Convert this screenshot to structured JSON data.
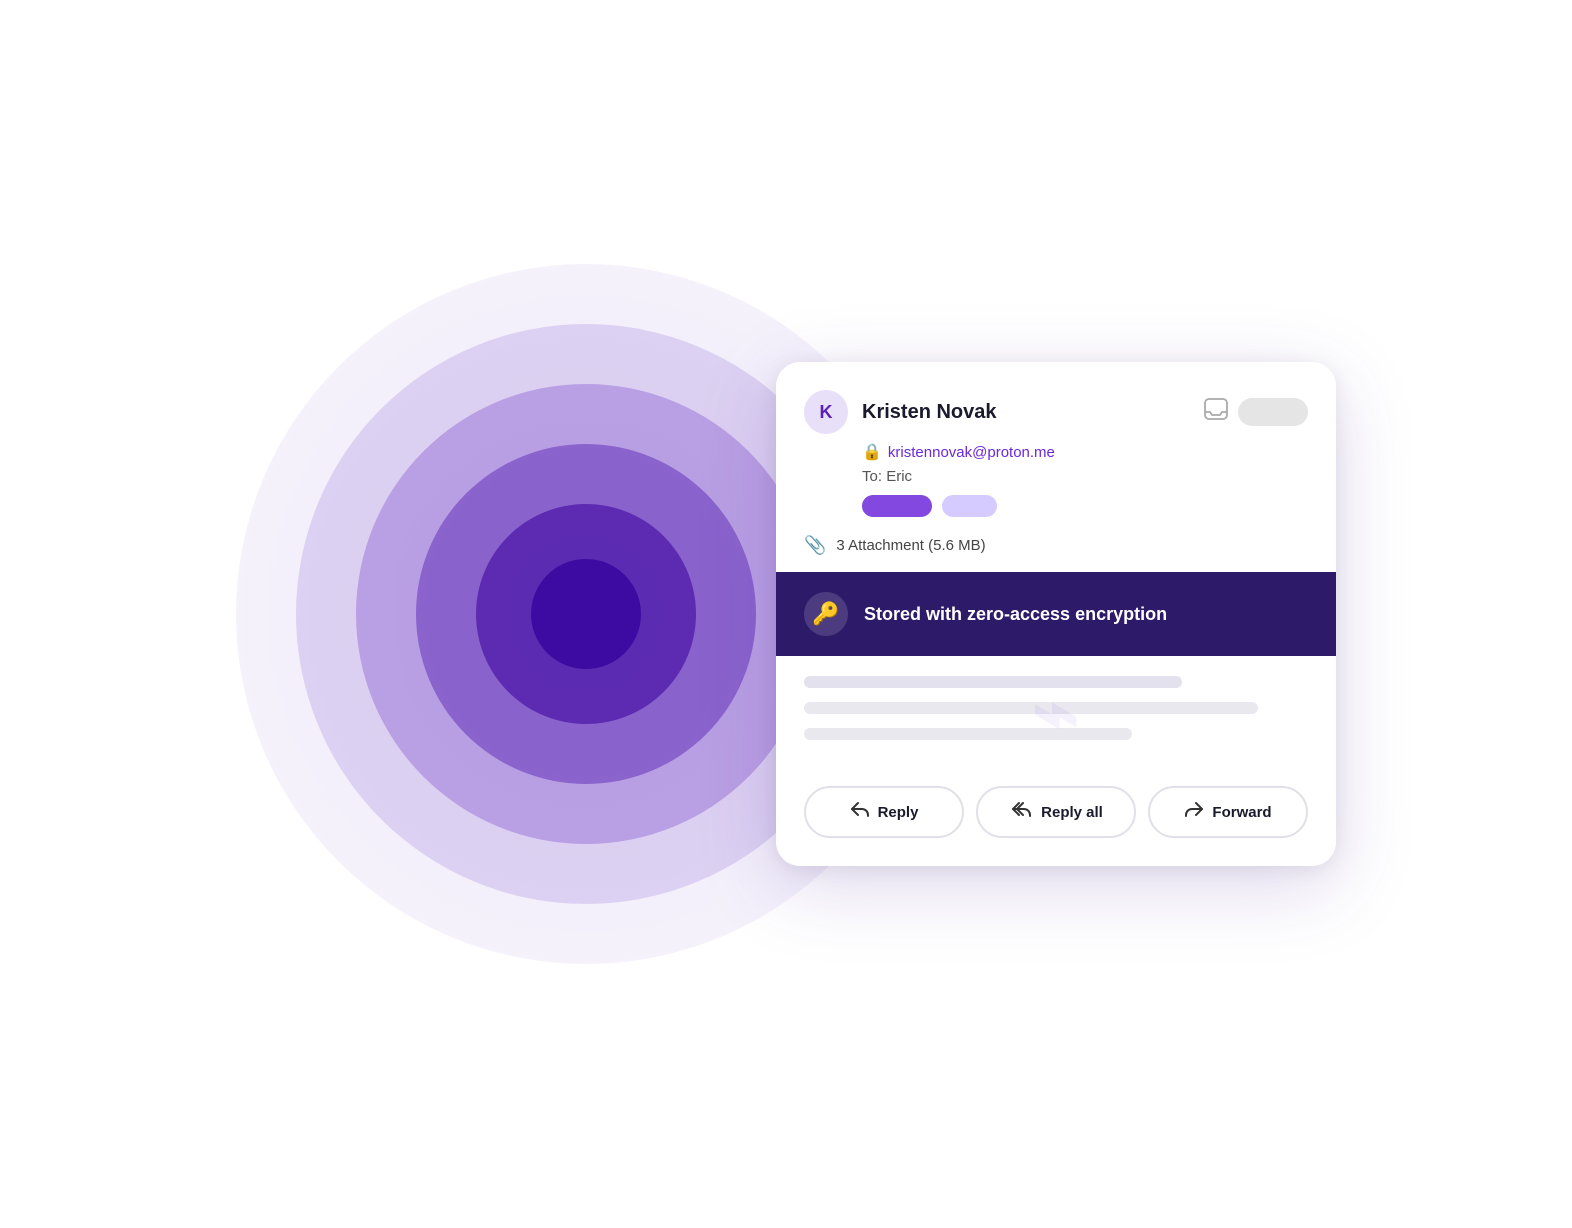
{
  "background": {
    "colors": {
      "outermost": "#e8e0f8",
      "ring2": "#c4b5fd",
      "ring3": "#a78bfa",
      "ring4": "#7c3aed",
      "ring5": "#5b21b6",
      "center": "#3b0f9e"
    }
  },
  "email_card": {
    "sender": {
      "avatar_letter": "K",
      "name": "Kristen Novak",
      "email": "kristennovak@proton.me",
      "to_label": "To:",
      "to_name": "Eric"
    },
    "attachment": {
      "icon": "📎",
      "text": "3 Attachment (5.6 MB)"
    },
    "encryption_banner": {
      "icon": "🔑",
      "text": "Stored with zero-access encryption"
    },
    "actions": {
      "reply": {
        "icon": "↩",
        "label": "Reply"
      },
      "reply_all": {
        "icon": "↩↩",
        "label": "Reply all"
      },
      "forward": {
        "icon": "↪",
        "label": "Forward"
      }
    }
  }
}
